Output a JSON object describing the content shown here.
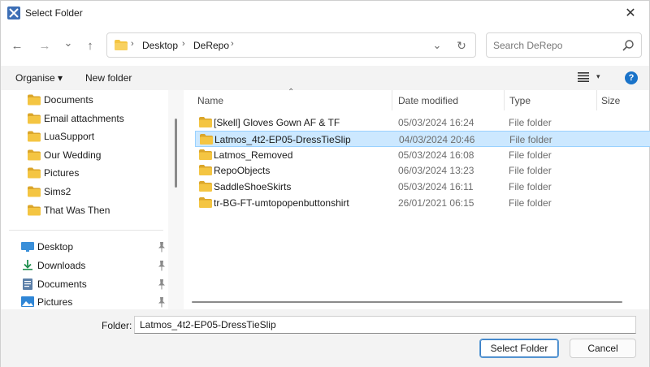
{
  "window": {
    "title": "Select Folder",
    "close_glyph": "✕"
  },
  "nav": {
    "back_glyph": "←",
    "forward_glyph": "→",
    "recent_glyph": "⌄",
    "up_glyph": "↑",
    "breadcrumb": [
      "Desktop",
      "DeRepo"
    ],
    "refresh_glyph": "↻",
    "search_placeholder": "Search DeRepo"
  },
  "toolbar": {
    "organise_label": "Organise ▾",
    "new_folder_label": "New folder",
    "view_chevron": "▾",
    "help_glyph": "?"
  },
  "sidebar": {
    "folders": [
      "Documents",
      "Email attachments",
      "LuaSupport",
      "Our Wedding",
      "Pictures",
      "Sims2",
      "That Was Then"
    ],
    "quick_access": [
      {
        "label": "Desktop",
        "icon": "desktop-icon"
      },
      {
        "label": "Downloads",
        "icon": "download-icon"
      },
      {
        "label": "Documents",
        "icon": "document-icon"
      },
      {
        "label": "Pictures",
        "icon": "pictures-icon"
      }
    ]
  },
  "file_list": {
    "columns": {
      "name": "Name",
      "date": "Date modified",
      "type": "Type",
      "size": "Size"
    },
    "sort_arrow": "⌃",
    "rows": [
      {
        "name": "[Skell] Gloves Gown AF & TF",
        "date": "05/03/2024 16:24",
        "type": "File folder",
        "selected": false
      },
      {
        "name": "Latmos_4t2-EP05-DressTieSlip",
        "date": "04/03/2024 20:46",
        "type": "File folder",
        "selected": true
      },
      {
        "name": "Latmos_Removed",
        "date": "05/03/2024 16:08",
        "type": "File folder",
        "selected": false
      },
      {
        "name": "RepoObjects",
        "date": "06/03/2024 13:23",
        "type": "File folder",
        "selected": false
      },
      {
        "name": "SaddleShoeSkirts",
        "date": "05/03/2024 16:11",
        "type": "File folder",
        "selected": false
      },
      {
        "name": "tr-BG-FT-umtopopenbuttonshirt",
        "date": "26/01/2021 06:15",
        "type": "File folder",
        "selected": false
      }
    ]
  },
  "footer": {
    "folder_label": "Folder:",
    "folder_value": "Latmos_4t2-EP05-DressTieSlip",
    "select_label": "Select Folder",
    "cancel_label": "Cancel"
  },
  "colors": {
    "folder": "#f4c542",
    "folder_dark": "#dba62a",
    "selection": "#cce8ff",
    "selection_border": "#99d1ff",
    "accent": "#1a73c9"
  }
}
